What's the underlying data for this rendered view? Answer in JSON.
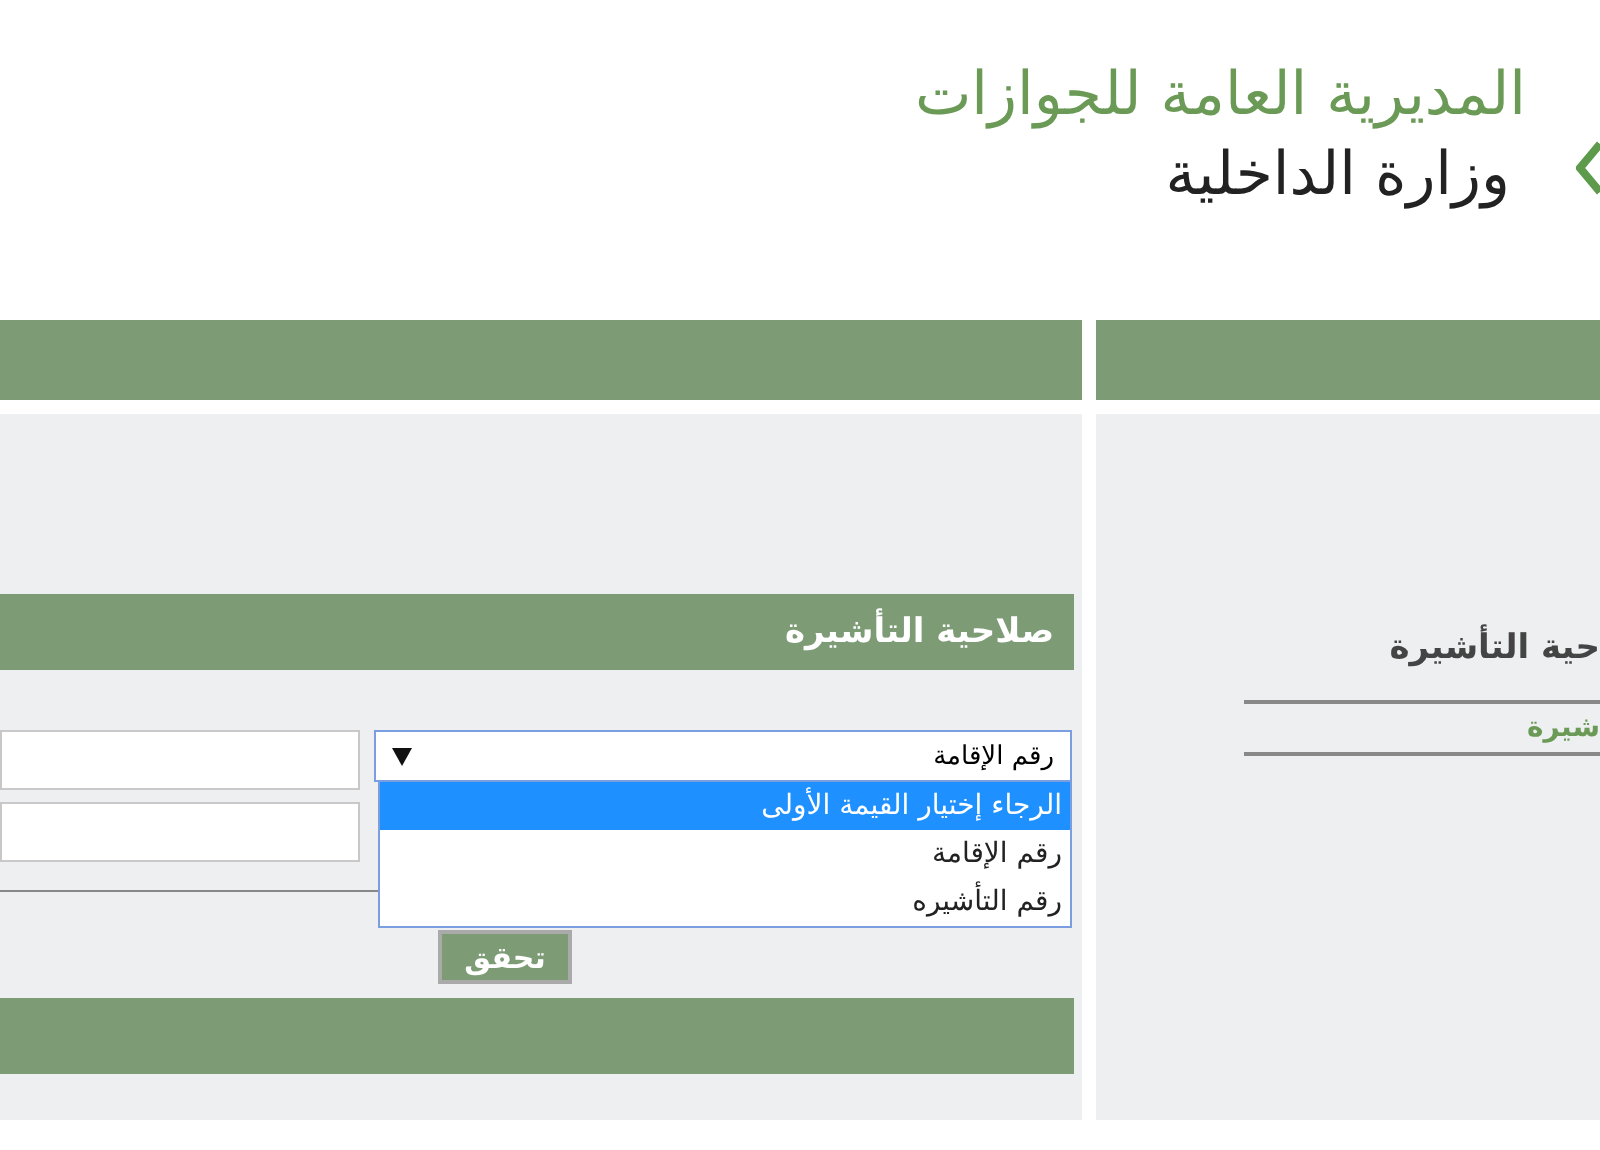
{
  "header": {
    "title": "المديرية العامة للجوازات",
    "subtitle": "وزارة الداخلية"
  },
  "left_panel": {
    "section_title": "صلاحية التأشيرة",
    "id_type": {
      "value": "رقم الإقامة",
      "expanded": true,
      "options": [
        {
          "label": "الرجاء إختيار القيمة الأولى",
          "highlighted": true
        },
        {
          "label": "رقم الإقامة",
          "highlighted": false
        },
        {
          "label": "رقم التأشيره",
          "highlighted": false
        }
      ]
    },
    "submit_button": "تحقق"
  },
  "right_panel": {
    "title": "حية التأشيرة",
    "link": "شيرة"
  }
}
